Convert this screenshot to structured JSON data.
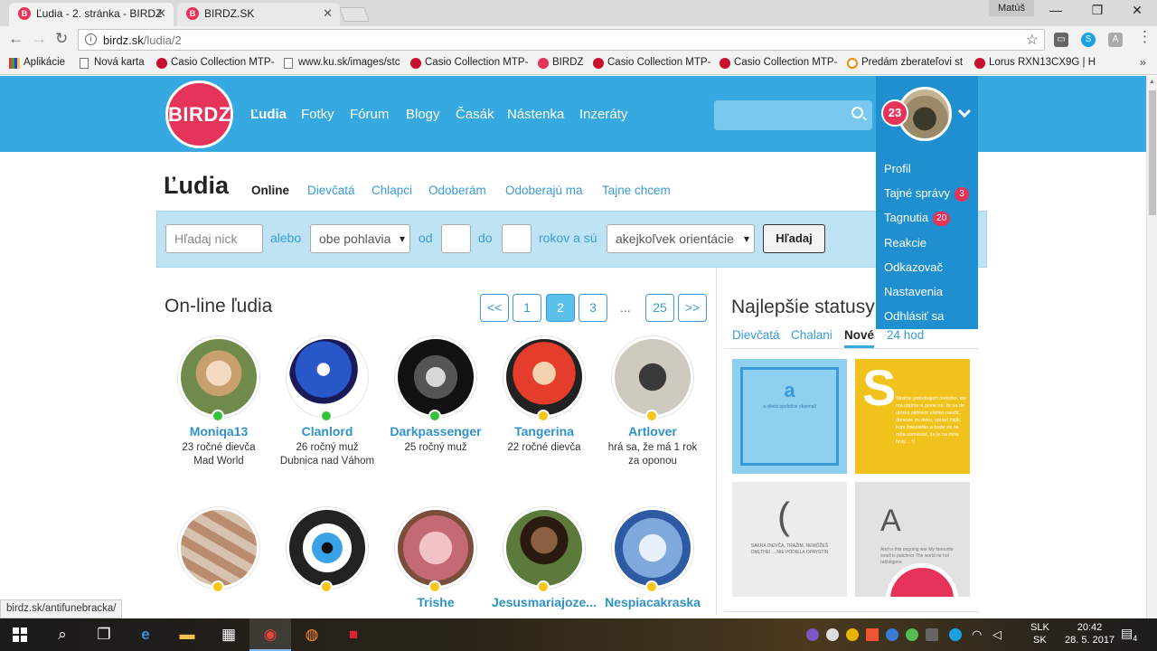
{
  "browser": {
    "tabs": [
      {
        "title": "Ľudia - 2. stránka - BIRDZ",
        "icon": "birdz-favicon",
        "active": true
      },
      {
        "title": "BIRDZ.SK",
        "icon": "birdz-favicon",
        "active": false
      }
    ],
    "user": "Matúš",
    "url_host": "birdz.sk",
    "url_path": "/ludia/2",
    "bookmarks": [
      {
        "label": "Aplikácie",
        "icon": "apps-grid-icon"
      },
      {
        "label": "Nová karta",
        "icon": "page-icon"
      },
      {
        "label": "Casio Collection MTP-",
        "icon": "casio-icon"
      },
      {
        "label": "www.ku.sk/images/stc",
        "icon": "page-icon"
      },
      {
        "label": "Casio Collection MTP-",
        "icon": "casio-icon"
      },
      {
        "label": "BIRDZ",
        "icon": "birdz-favicon"
      },
      {
        "label": "Casio Collection MTP-",
        "icon": "casio-icon"
      },
      {
        "label": "Casio Collection MTP-",
        "icon": "casio-icon"
      },
      {
        "label": "Predám zberateľovi st",
        "icon": "bazos-icon"
      },
      {
        "label": "Lorus RXN13CX9G | H",
        "icon": "casio-icon"
      }
    ],
    "status_url": "birdz.sk/antifunebracka/"
  },
  "site": {
    "logo": "BIRDZ",
    "nav": [
      "Ľudia",
      "Fotky",
      "Fórum",
      "Blogy",
      "Časák",
      "Nástenka",
      "Inzeráty"
    ],
    "nav_active": 0,
    "notification_count": "23",
    "user_menu": [
      {
        "label": "Profil",
        "badge": ""
      },
      {
        "label": "Tajné správy",
        "badge": "3"
      },
      {
        "label": "Tagnutia",
        "badge": "20"
      },
      {
        "label": "Reakcie",
        "badge": ""
      },
      {
        "label": "Odkazovač",
        "badge": ""
      },
      {
        "label": "Nastavenia",
        "badge": ""
      },
      {
        "label": "Odhlásiť sa",
        "badge": ""
      }
    ]
  },
  "page": {
    "title": "Ľudia",
    "tabs": [
      "Online",
      "Dievčatá",
      "Chlapci",
      "Odoberám",
      "Odoberajú ma",
      "Tajne chcem"
    ],
    "tab_active": 0
  },
  "filter": {
    "nick_placeholder": "Hľadaj nick",
    "label_or": "alebo",
    "gender_value": "obe pohlavia",
    "label_from": "od",
    "label_to": "do",
    "label_years": "rokov a sú",
    "orientation_value": "akejkoľvek orientácie",
    "search_button": "Hľadaj"
  },
  "online": {
    "title": "On-line ľudia",
    "pager": [
      "<<",
      "1",
      "2",
      "3",
      "...",
      "25",
      ">>"
    ],
    "pager_current": "2",
    "people": [
      {
        "name": "Moniqa13",
        "line1": "23 ročné dievča",
        "line2": "Mad World",
        "status": "online"
      },
      {
        "name": "Clanlord",
        "line1": "26 ročný muž",
        "line2": "Dubnica nad Váhom",
        "status": "online"
      },
      {
        "name": "Darkpassenger",
        "line1": "25 ročný muž",
        "line2": "",
        "status": "online"
      },
      {
        "name": "Tangerina",
        "line1": "22 ročné dievča",
        "line2": "",
        "status": "away"
      },
      {
        "name": "Artlover",
        "line1": "hrá sa, že má 1 rok",
        "line2": "za oponou",
        "status": "away"
      },
      {
        "name": "",
        "line1": "",
        "line2": "",
        "status": "away"
      },
      {
        "name": "",
        "line1": "",
        "line2": "",
        "status": "away"
      },
      {
        "name": "Trishe",
        "line1": "",
        "line2": "",
        "status": "away"
      },
      {
        "name": "Jesusmariajoze...",
        "line1": "",
        "line2": "",
        "status": "away"
      },
      {
        "name": "Nespiacakraska",
        "line1": "",
        "line2": "",
        "status": "away"
      }
    ]
  },
  "statuses": {
    "title": "Najlepšie statusy",
    "tabs": [
      "Dievčatá",
      "Chalani",
      "Nové",
      "24 hod"
    ],
    "tab_active": 2,
    "tiles": [
      {
        "big": "a",
        "small": "a všetci spoločne objemali"
      },
      {
        "big": "S",
        "small": "Stratne potrebujem niekoho, kto ma objíme a povie mi, že sa do utorka stihnem všetko naučiť, donesie mi deku, spraví čajík, kúpi čokoládku a bude sa na mňa usmievať, že je na mňa hrdý... :'("
      },
      {
        "big": "(",
        "small": "SAKRA DIEVČA, TRAŽIM, NEMÔŽEŠ OMLTHEI ... NIE PODIELA OPAYSTIN"
      },
      {
        "big": "A",
        "small": "And in this ongoing war My favourite smell is patchnor The world ne hol rabbitgpea"
      }
    ]
  },
  "taskbar": {
    "lang_top": "SLK",
    "lang_bottom": "SK",
    "time": "20:42",
    "date": "28. 5. 2017",
    "notifications": "4"
  },
  "colors": {
    "header": "#36a9e1",
    "accent": "#e6335a",
    "link": "#3a9ad9"
  }
}
